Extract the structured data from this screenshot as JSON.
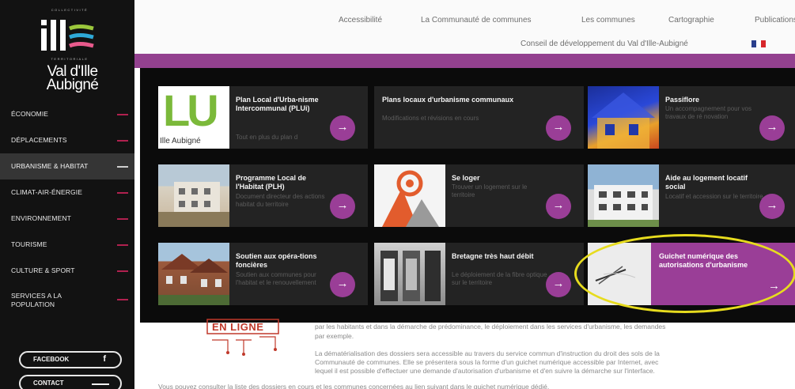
{
  "logo": {
    "top_text": "COLLECTIVITÉ",
    "bottom_text": "TERRITORIALE",
    "name_line1": "Val d'Ille",
    "name_line2": "Aubigné",
    "colors": {
      "mark": "#ffffff",
      "stripe1": "#9bc73c",
      "stripe2": "#2ea9d8",
      "stripe3": "#e85a8c"
    }
  },
  "sidebar": {
    "items": [
      {
        "label": "ÉCONOMIE",
        "active": false
      },
      {
        "label": "DÉPLACEMENTS",
        "active": false
      },
      {
        "label": "URBANISME & HABITAT",
        "active": true
      },
      {
        "label": "CLIMAT-AIR-ÉNERGIE",
        "active": false
      },
      {
        "label": "ENVIRONNEMENT",
        "active": false
      },
      {
        "label": "TOURISME",
        "active": false
      },
      {
        "label": "CULTURE & SPORT",
        "active": false
      },
      {
        "label_line1": "SERVICES A LA",
        "label_line2": "POPULATION",
        "active": false
      }
    ],
    "facebook_label": "FACEBOOK",
    "facebook_icon": "f",
    "contact_label": "CONTACT"
  },
  "topbar": {
    "links": [
      "Accessibilité",
      "La Communauté de communes",
      "Les communes",
      "Cartographie",
      "Publications"
    ],
    "sub_link": "Conseil de développement du Val d'Ille-Aubigné",
    "flag_colors": [
      "#2b3f8c",
      "#ffffff",
      "#d7262b"
    ]
  },
  "cards": [
    {
      "title": "Plan Local d'Urba-nisme Intercommunal (PLUi)",
      "desc": "Tout en plus du plan d",
      "thumb": "plui-logo",
      "thumb_text": "LU",
      "thumb_sub": "Ille Aubigné"
    },
    {
      "title": "Plans locaux d'urbanisme communaux",
      "desc": "Modifications et révisions en cours",
      "thumb": "none"
    },
    {
      "title": "Passiflore",
      "desc": "Un accompagnement pour vos travaux de ré novation",
      "thumb": "thermal-house"
    },
    {
      "title": "Programme Local de l'Habitat (PLH)",
      "desc": "Document directeur des actions habitat du territoire",
      "thumb": "building-photo"
    },
    {
      "title": "Se loger",
      "desc": "Trouver un logement sur le territoire",
      "thumb": "logo-orange"
    },
    {
      "title": "Aide au logement locatif social",
      "desc": "Locatif et accession sur le territoire",
      "thumb": "apartment-photo"
    },
    {
      "title": "Soutien aux opéra-tions foncières",
      "desc": "Soutien aux communes pour l'habitat et le renouvellement",
      "thumb": "brick-houses"
    },
    {
      "title": "Bretagne très haut débit",
      "desc": "Le déploiement de la fibre optique sur le territoire",
      "thumb": "fiber-photo"
    },
    {
      "title": "Guichet numérique des autorisations d'urbanisme",
      "desc": "",
      "thumb": "pen-paper",
      "highlight": true
    }
  ],
  "body": {
    "stamp_text": "EN LIGNE",
    "lines": [
      "par les habitants et dans la démarche de prédominance, le déploiement dans les services d'urbanisme, les demandes",
      "par exemple.",
      "La dématérialisation des dossiers sera accessible au travers du service commun d'instruction du droit des sols de la",
      "Communauté de communes. Elle se présentera sous la forme d'un guichet numérique accessible par Internet, avec",
      "lequel il est possible d'effectuer une demande d'autorisation d'urbanisme et d'en suivre la démarche sur l'interface.",
      "Vous pouvez consulter la liste des dossiers en cours et les communes concernées au lien suivant dans le guichet numérique dédié."
    ]
  },
  "accent_color": "#9a3e97"
}
